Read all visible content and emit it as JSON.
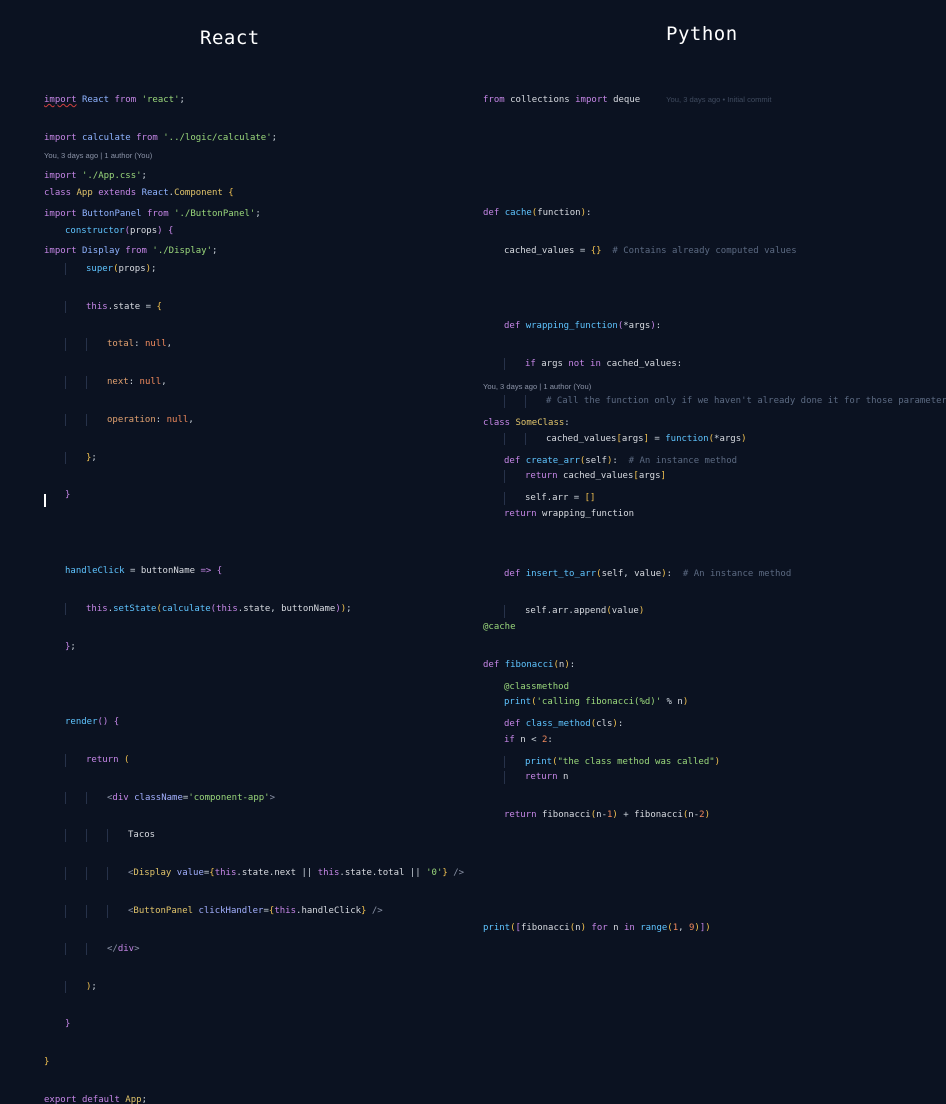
{
  "left": {
    "title": "React",
    "blame": "You, 3 days ago | 1 author (You)"
  },
  "right": {
    "title": "Python",
    "inline_blame": "You, 3 days ago • Initial commit",
    "blame": "You, 3 days ago | 1 author (You)"
  }
}
